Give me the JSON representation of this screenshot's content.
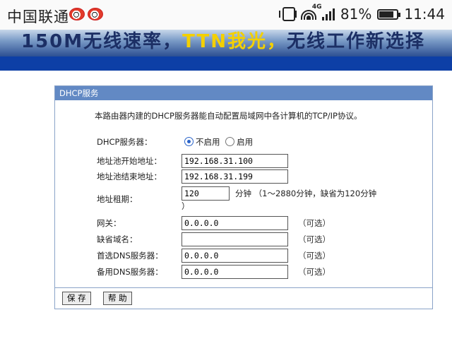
{
  "statusbar": {
    "carrier": "中国联通",
    "signal_type": "4G",
    "battery": "81%",
    "time": "11:44",
    "battery_level": 0.81
  },
  "banner": {
    "text_a": "150M无线速率，",
    "text_b": "TTN我光，",
    "text_c": "无线工作新选择"
  },
  "panel": {
    "title": "DHCP服务",
    "description": "本路由器内建的DHCP服务器能自动配置局域网中各计算机的TCP/IP协议。",
    "dhcp_server": {
      "label": "DHCP服务器：",
      "option_disable": "不启用",
      "option_enable": "启用",
      "selected": "不启用"
    },
    "pool_start": {
      "label": "地址池开始地址：",
      "value": "192.168.31.100"
    },
    "pool_end": {
      "label": "地址池结束地址：",
      "value": "192.168.31.199"
    },
    "lease": {
      "label": "地址租期：",
      "value": "120",
      "unit_note": "分钟 （1～2880分钟，缺省为120分钟",
      "unit_note_end": "）"
    },
    "gateway": {
      "label": "网关：",
      "value": "0.0.0.0",
      "optional": "（可选）"
    },
    "domain": {
      "label": "缺省域名：",
      "value": "",
      "optional": "（可选）"
    },
    "primary_dns": {
      "label": "首选DNS服务器：",
      "value": "0.0.0.0",
      "optional": "（可选）"
    },
    "secondary_dns": {
      "label": "备用DNS服务器：",
      "value": "0.0.0.0",
      "optional": "（可选）"
    },
    "save_label": "保 存",
    "help_label": "帮 助"
  },
  "colors": {
    "header": "#6289c4",
    "bluebar": "#0d3fa6",
    "radio_on": "#2a63c8"
  }
}
